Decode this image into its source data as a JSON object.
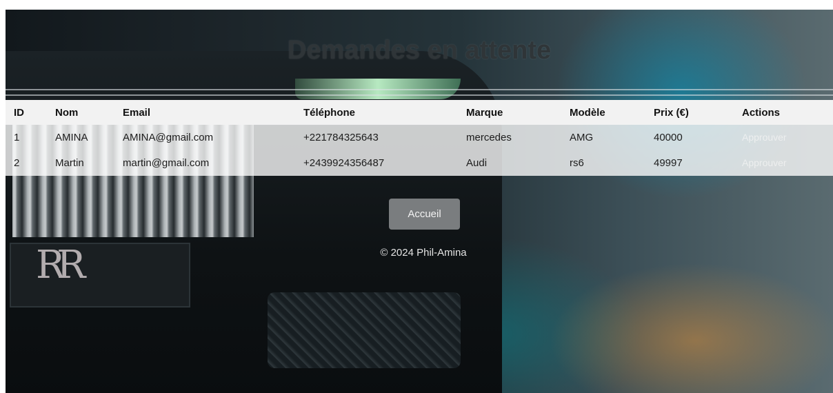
{
  "page": {
    "title": "Demandes en attente"
  },
  "table": {
    "headers": [
      "ID",
      "Nom",
      "Email",
      "Téléphone",
      "Marque",
      "Modèle",
      "Prix (€)",
      "Actions"
    ],
    "rows": [
      {
        "id": "1",
        "nom": "AMINA",
        "email": "AMINA@gmail.com",
        "telephone": "+221784325643",
        "marque": "mercedes",
        "modele": "AMG",
        "prix": "40000",
        "action": "Approuver"
      },
      {
        "id": "2",
        "nom": "Martin",
        "email": "martin@gmail.com",
        "telephone": "+2439924356487",
        "marque": "Audi",
        "modele": "rs6",
        "prix": "49997",
        "action": "Approuver"
      }
    ]
  },
  "nav": {
    "home_label": "Accueil"
  },
  "footer": {
    "copyright": "© 2024 Phil-Amina"
  },
  "colors": {
    "header_bg": "#f2f2f2",
    "button_bg": "#7a7d7f",
    "title": "#2f3538"
  }
}
